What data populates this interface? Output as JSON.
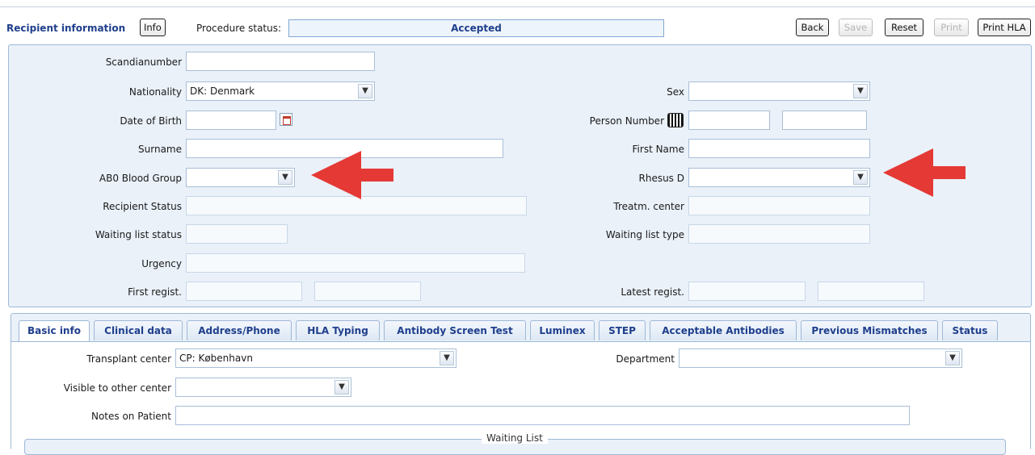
{
  "header": {
    "title": "Recipient information",
    "info_label": "Info",
    "status_label": "Procedure status:",
    "status_value": "Accepted",
    "buttons": {
      "back": "Back",
      "save": "Save",
      "reset": "Reset",
      "print": "Print",
      "print_hla": "Print HLA"
    }
  },
  "form": {
    "scandianumber": {
      "label": "Scandianumber",
      "value": ""
    },
    "nationality": {
      "label": "Nationality",
      "value": "DK: Denmark"
    },
    "date_of_birth": {
      "label": "Date of Birth",
      "value": ""
    },
    "surname": {
      "label": "Surname",
      "value": ""
    },
    "abo_blood_group": {
      "label": "AB0 Blood Group",
      "value": ""
    },
    "recipient_status": {
      "label": "Recipient Status",
      "value": ""
    },
    "waiting_list_status": {
      "label": "Waiting list status",
      "value": ""
    },
    "urgency": {
      "label": "Urgency",
      "value": ""
    },
    "first_regist": {
      "label": "First regist.",
      "value1": "",
      "value2": ""
    },
    "sex": {
      "label": "Sex",
      "value": ""
    },
    "person_number": {
      "label": "Person Number",
      "value1": "",
      "value2": ""
    },
    "first_name": {
      "label": "First Name",
      "value": ""
    },
    "rhesus_d": {
      "label": "Rhesus D",
      "value": ""
    },
    "treatm_center": {
      "label": "Treatm. center",
      "value": ""
    },
    "waiting_list_type": {
      "label": "Waiting list type",
      "value": ""
    },
    "latest_regist": {
      "label": "Latest regist.",
      "value1": "",
      "value2": ""
    }
  },
  "tabs": [
    {
      "label": "Basic info",
      "active": true
    },
    {
      "label": "Clinical data"
    },
    {
      "label": "Address/Phone"
    },
    {
      "label": "HLA Typing"
    },
    {
      "label": "Antibody Screen Test"
    },
    {
      "label": "Luminex"
    },
    {
      "label": "STEP"
    },
    {
      "label": "Acceptable Antibodies"
    },
    {
      "label": "Previous Mismatches"
    },
    {
      "label": "Status"
    }
  ],
  "basic_info": {
    "transplant_center": {
      "label": "Transplant center",
      "value": "CP: København"
    },
    "department": {
      "label": "Department",
      "value": ""
    },
    "visible_to_other_center": {
      "label": "Visible to other center",
      "value": ""
    },
    "notes_on_patient": {
      "label": "Notes on Patient",
      "value": ""
    },
    "waiting_list_legend": "Waiting List"
  },
  "colors": {
    "accent": "#1f3f8c",
    "panel": "#eaf1f9",
    "arrow": "#e53935"
  },
  "icons": {
    "dropdown": "chevron-down-icon",
    "calendar": "calendar-icon",
    "barcode": "barcode-icon",
    "arrow": "arrow-left-icon"
  }
}
